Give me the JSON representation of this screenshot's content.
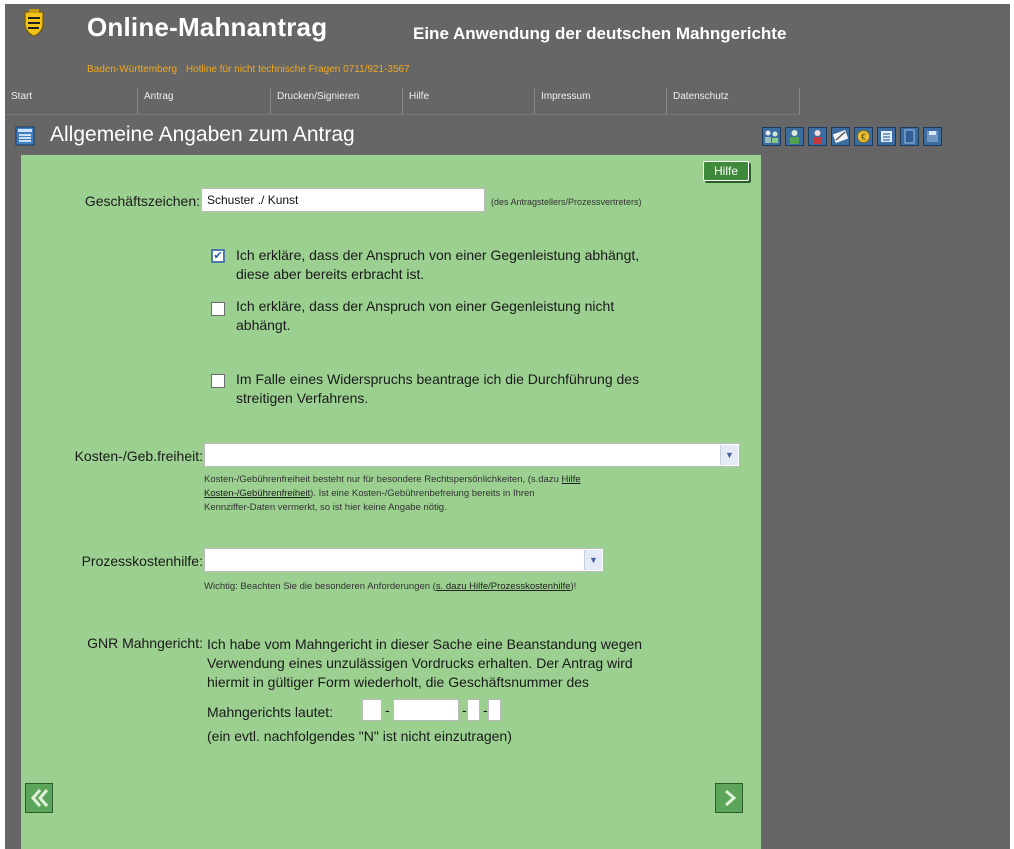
{
  "header": {
    "app_title": "Online-Mahnantrag",
    "app_subtitle": "Eine Anwendung der deutschen Mahngerichte",
    "state": "Baden-Württemberg",
    "hotline": "Hotline für nicht technische Fragen 0711/921-3567",
    "crest_icon": "coat-of-arms-icon"
  },
  "nav": {
    "items": [
      "Start",
      "Antrag",
      "Drucken/Signieren",
      "Hilfe",
      "Impressum",
      "Datenschutz"
    ]
  },
  "page": {
    "title": "Allgemeine Angaben zum Antrag",
    "icon": "form-list-icon"
  },
  "toolbar": {
    "icons": [
      "persons-icon",
      "person-green-icon",
      "person-red-icon",
      "edit-document-icon",
      "money-icon",
      "list-icon",
      "page-icon",
      "save-icon"
    ]
  },
  "form": {
    "help_label": "Hilfe",
    "geschaeftszeichen": {
      "label": "Geschäftszeichen:",
      "value": "Schuster ./ Kunst",
      "hint": "(des Antragstellers/Prozessvertreters)"
    },
    "checkboxes": [
      {
        "line1": "Ich erkläre, dass der Anspruch von einer Gegenleistung abhängt,",
        "line2": "diese aber bereits erbracht ist.",
        "checked": true
      },
      {
        "line1": "Ich erkläre, dass der Anspruch von einer Gegenleistung nicht",
        "line2": "abhängt.",
        "checked": false
      },
      {
        "line1": "Im Falle eines Widerspruchs beantrage ich die Durchführung des",
        "line2": "streitigen Verfahrens.",
        "checked": false
      }
    ],
    "kosten": {
      "label": "Kosten-/Geb.freiheit:",
      "value": "",
      "hint_line1_pre": "Kosten-/Gebührenfreiheit besteht nur für besondere Rechtspersönlichkeiten, (s.dazu",
      "hint_link_a": "Hilfe",
      "hint_link_b": "Kosten-/Gebührenfreiheit",
      "hint_line2_post": "). Ist eine Kosten-/Gebührenbefreiung bereits in Ihren",
      "hint_line3": "Kennziffer-Daten vermerkt, so ist hier keine Angabe nötig."
    },
    "pkh": {
      "label": "Prozesskostenhilfe:",
      "value": "",
      "hint_pre": "Wichtig: Beachten Sie die besonderen Anforderungen (",
      "hint_link": "s. dazu Hilfe/Prozesskostenhilfe",
      "hint_post": ")!"
    },
    "gnr": {
      "label": "GNR Mahngericht:",
      "line1": "Ich habe vom Mahngericht in dieser Sache eine Beanstandung wegen",
      "line2": "Verwendung eines unzulässigen Vordrucks erhalten. Der Antrag wird",
      "line3": "hiermit in gültiger Form wiederholt, die Geschäftsnummer des",
      "line4": "Mahngerichts lautet:",
      "note": "(ein evtl. nachfolgendes \"N\" ist nicht einzutragen)",
      "sep": "-"
    },
    "back_icon": "rewind-icon",
    "next_icon": "forward-icon"
  }
}
